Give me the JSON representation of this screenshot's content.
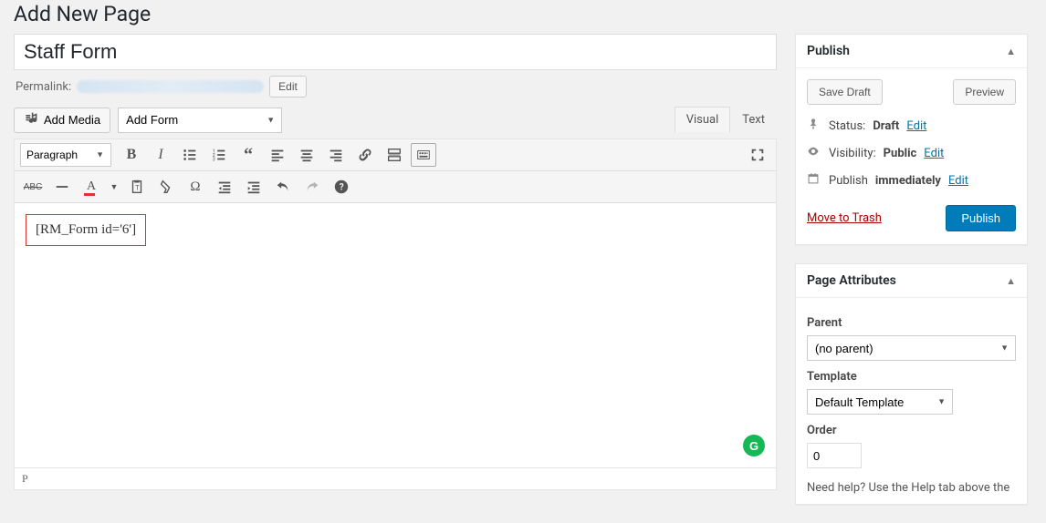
{
  "page_heading": "Add New Page",
  "title_value": "Staff Form",
  "permalink_label": "Permalink:",
  "permalink_edit": "Edit",
  "add_media": "Add Media",
  "add_form_selected": "Add Form",
  "tabs": {
    "visual": "Visual",
    "text": "Text"
  },
  "format_selected": "Paragraph",
  "content_shortcode": "[RM_Form id='6']",
  "status_path": "P",
  "publish": {
    "title": "Publish",
    "save_draft": "Save Draft",
    "preview": "Preview",
    "status_label": "Status:",
    "status_value": "Draft",
    "status_edit": "Edit",
    "visibility_label": "Visibility:",
    "visibility_value": "Public",
    "visibility_edit": "Edit",
    "schedule_label": "Publish",
    "schedule_value": "immediately",
    "schedule_edit": "Edit",
    "trash": "Move to Trash",
    "publish_btn": "Publish"
  },
  "attributes": {
    "title": "Page Attributes",
    "parent_label": "Parent",
    "parent_value": "(no parent)",
    "template_label": "Template",
    "template_value": "Default Template",
    "order_label": "Order",
    "order_value": "0",
    "help": "Need help? Use the Help tab above the"
  }
}
